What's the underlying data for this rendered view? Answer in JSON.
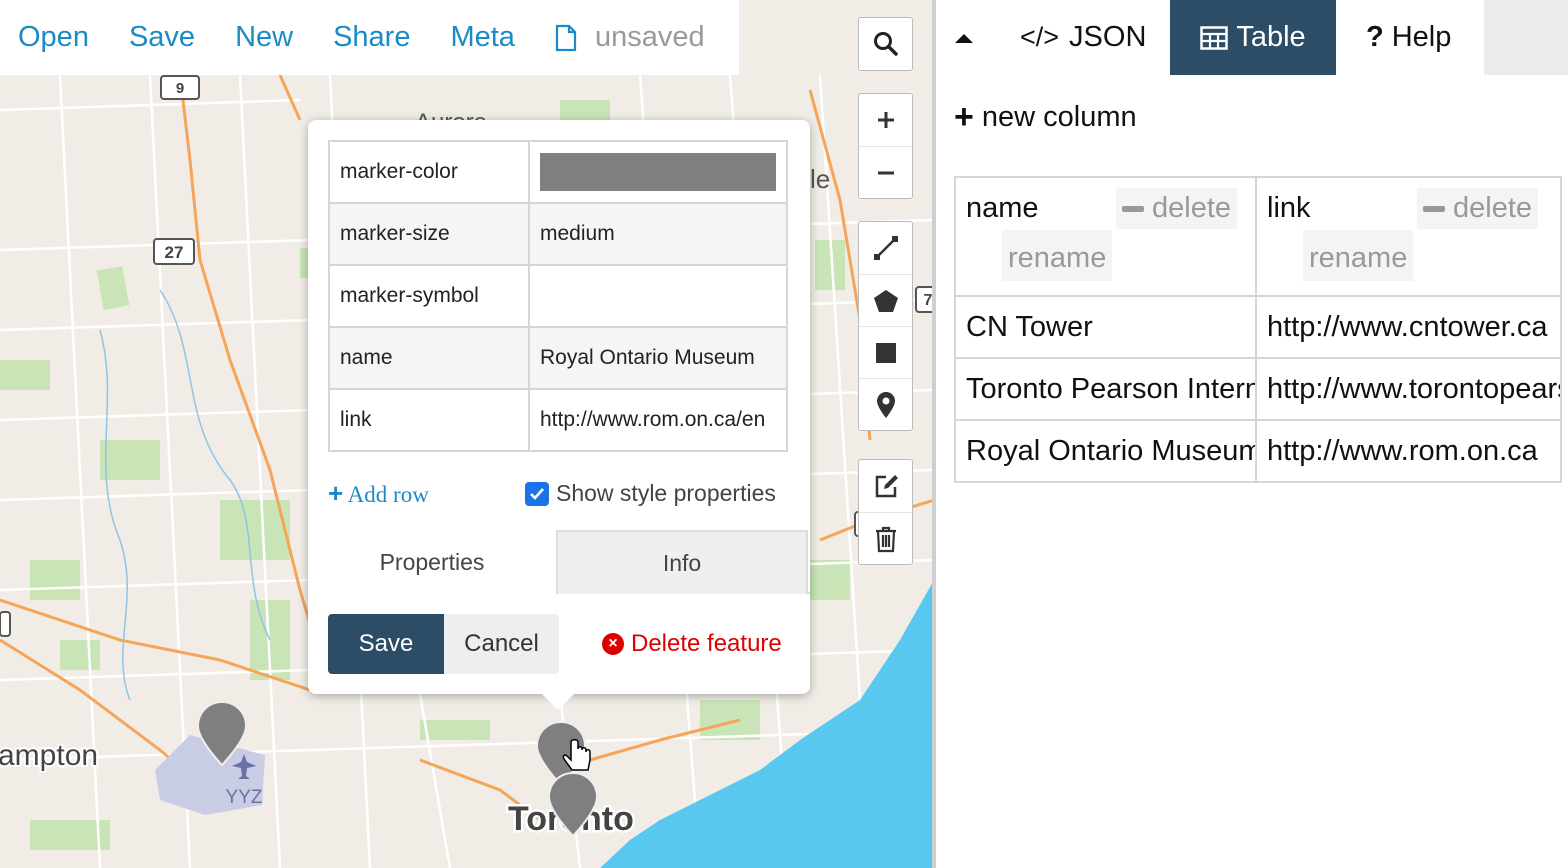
{
  "toolbar": {
    "open": "Open",
    "save": "Save",
    "new": "New",
    "share": "Share",
    "meta": "Meta",
    "file_status": "unsaved"
  },
  "map_labels": {
    "road_9": "9",
    "road_27": "27",
    "road_7": "7",
    "aurora": "Aurora",
    "le": "le",
    "brampton": "ampton",
    "toronto": "Toronto",
    "airport": "YYZ"
  },
  "popup": {
    "properties": [
      {
        "key": "marker-color",
        "value": ""
      },
      {
        "key": "marker-size",
        "value": "medium"
      },
      {
        "key": "marker-symbol",
        "value": ""
      },
      {
        "key": "name",
        "value": "Royal Ontario Museum"
      },
      {
        "key": "link",
        "value": "http://www.rom.on.ca/en"
      }
    ],
    "marker_color_hex": "#7f7f7f",
    "add_row": "Add row",
    "show_style": "Show style properties",
    "show_style_checked": true,
    "tab_properties": "Properties",
    "tab_info": "Info",
    "save": "Save",
    "cancel": "Cancel",
    "delete": "Delete feature"
  },
  "right": {
    "tabs": {
      "json": "JSON",
      "table": "Table",
      "help": "Help"
    },
    "new_column": "new column",
    "columns": [
      {
        "name": "name",
        "delete": "delete",
        "rename": "rename"
      },
      {
        "name": "link",
        "delete": "delete",
        "rename": "rename"
      }
    ],
    "rows": [
      [
        "CN Tower",
        "http://www.cntower.ca"
      ],
      [
        "Toronto Pearson International Airport",
        "http://www.torontopearson.com"
      ],
      [
        "Royal Ontario Museum",
        "http://www.rom.on.ca"
      ]
    ]
  },
  "colors": {
    "link_blue": "#1b8ac6",
    "active_tab": "#2d4c66",
    "delete_red": "#dd0000",
    "water": "#59c8f0",
    "marker": "#7f7f7f"
  }
}
